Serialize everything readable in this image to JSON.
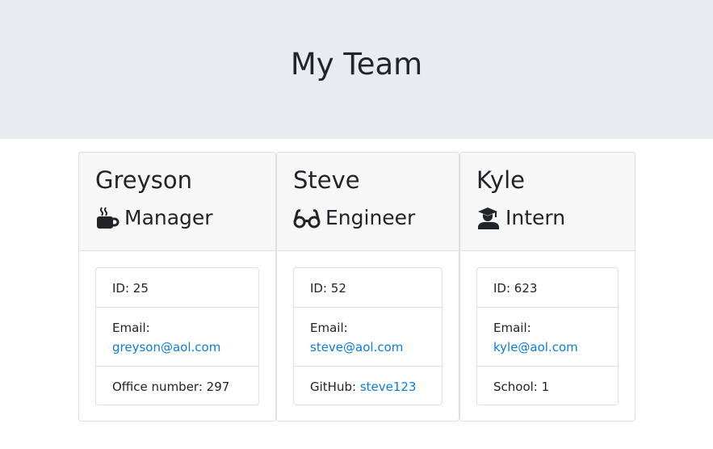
{
  "header": {
    "title": "My Team"
  },
  "employees": [
    {
      "name": "Greyson",
      "role": "Manager",
      "role_icon": "coffee-mug-icon",
      "id_label": "ID: 25",
      "email_label": "Email:",
      "email": "greyson@aol.com",
      "extra_label": "Office number: 297",
      "extra_link": ""
    },
    {
      "name": "Steve",
      "role": "Engineer",
      "role_icon": "glasses-icon",
      "id_label": "ID: 52",
      "email_label": "Email:",
      "email": "steve@aol.com",
      "extra_label": "GitHub: ",
      "extra_link": "steve123"
    },
    {
      "name": "Kyle",
      "role": "Intern",
      "role_icon": "graduate-icon",
      "id_label": "ID: 623",
      "email_label": "Email:",
      "email": "kyle@aol.com",
      "extra_label": "School: 1",
      "extra_link": ""
    }
  ],
  "colors": {
    "header_bg": "#e9ecef",
    "card_header_bg": "#f7f7f7",
    "link": "#0b7dda"
  }
}
